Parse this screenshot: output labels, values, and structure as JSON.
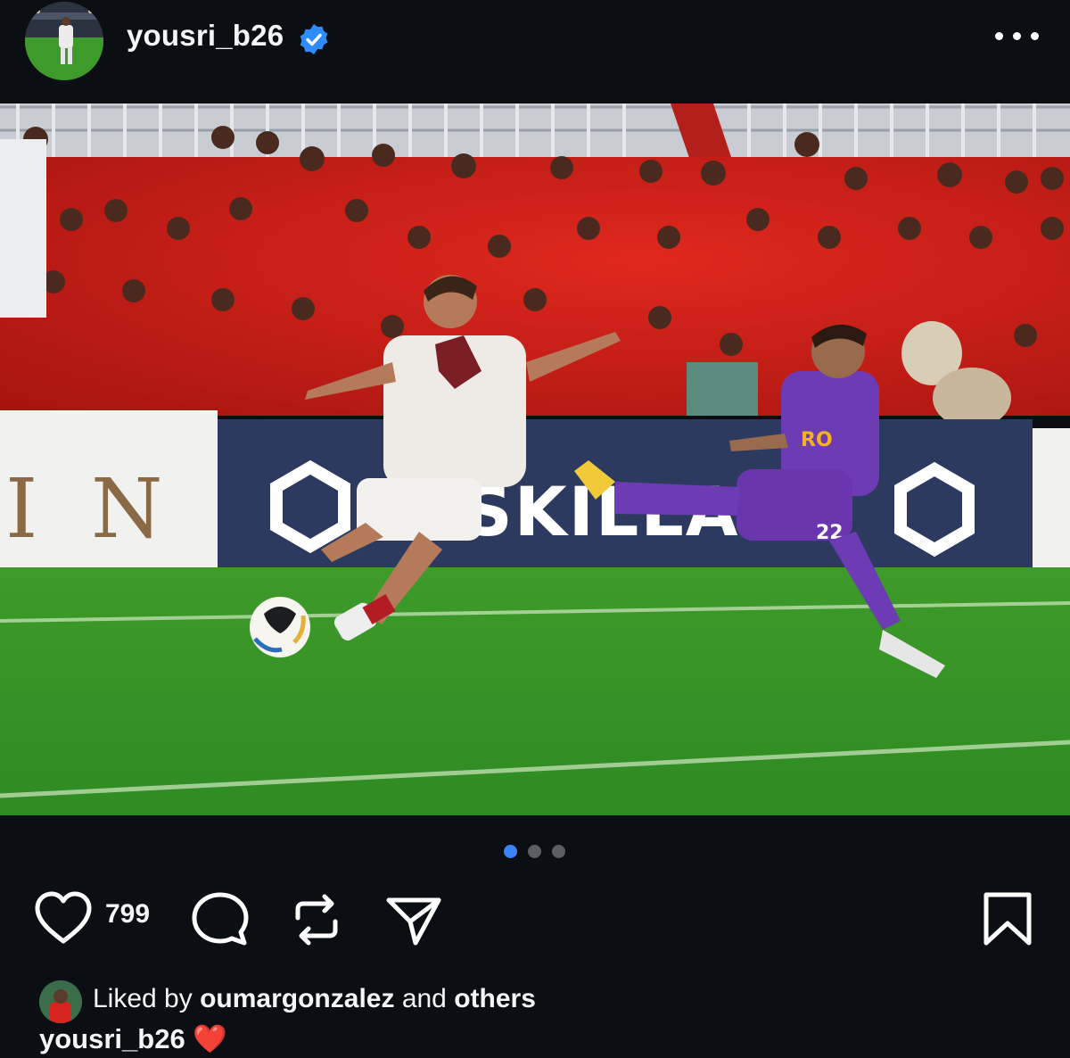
{
  "post": {
    "username": "yousri_b26",
    "verified": true,
    "more_icon": "ellipsis-icon",
    "carousel": {
      "count": 3,
      "active_index": 0
    },
    "actions": {
      "like_count": "799",
      "icons": [
        "heart-icon",
        "comment-icon",
        "repost-icon",
        "share-icon",
        "bookmark-icon"
      ]
    },
    "liked_by": {
      "prefix": "Liked by",
      "user": "oumargonzalez",
      "connector": "and",
      "suffix": "others"
    },
    "caption": {
      "username": "yousri_b26",
      "text": "❤️"
    },
    "photo": {
      "sponsor_board_left": "I N",
      "sponsor_board_text": "SKILLANO",
      "player_number": "22"
    }
  },
  "colors": {
    "background": "#0b0f13",
    "verified_blue": "#2f8cff",
    "active_dot": "#3b82f6",
    "inactive_dot": "#5a5d62",
    "crowd_red": "#d8241f",
    "pitch_green": "#3f9a2c",
    "purple_kit": "#6d3bb3"
  }
}
